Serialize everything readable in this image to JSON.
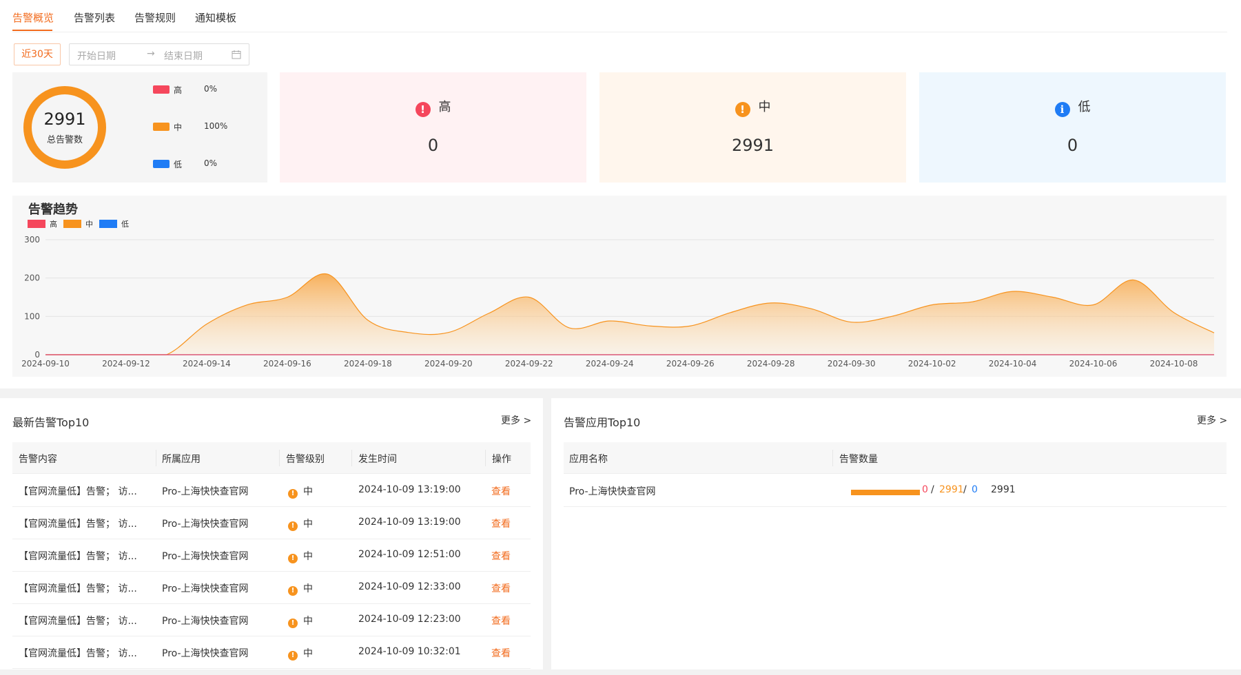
{
  "tabs": [
    {
      "label": "告警概览",
      "active": true
    },
    {
      "label": "告警列表",
      "active": false
    },
    {
      "label": "告警规则",
      "active": false
    },
    {
      "label": "通知模板",
      "active": false
    }
  ],
  "filter": {
    "quick_range": "近30天",
    "start_placeholder": "开始日期",
    "end_placeholder": "结束日期",
    "separator": "→"
  },
  "summary": {
    "total": "2991",
    "total_label": "总告警数",
    "levels": [
      {
        "name": "高",
        "percent": "0%",
        "color": "#f5475c"
      },
      {
        "name": "中",
        "percent": "100%",
        "color": "#f7931e"
      },
      {
        "name": "低",
        "percent": "0%",
        "color": "#1f7cf5"
      }
    ]
  },
  "level_cards": [
    {
      "name": "高",
      "count": "0",
      "icon": "exclamation-icon",
      "icon_color": "#f5475c",
      "bg": "#fff2f3"
    },
    {
      "name": "中",
      "count": "2991",
      "icon": "exclamation-icon",
      "icon_color": "#f7931e",
      "bg": "#fff6ed"
    },
    {
      "name": "低",
      "count": "0",
      "icon": "info-icon",
      "icon_color": "#1f7cf5",
      "bg": "#eef7fe"
    }
  ],
  "chart_data": {
    "type": "area",
    "title": "告警趋势",
    "xlabel": "",
    "ylabel": "",
    "ylim": [
      0,
      300
    ],
    "yticks": [
      0,
      100,
      200,
      300
    ],
    "x_tick_labels": [
      "2024-09-10",
      "2024-09-12",
      "2024-09-14",
      "2024-09-16",
      "2024-09-18",
      "2024-09-20",
      "2024-09-22",
      "2024-09-24",
      "2024-09-26",
      "2024-09-28",
      "2024-09-30",
      "2024-10-02",
      "2024-10-04",
      "2024-10-06",
      "2024-10-08"
    ],
    "x": [
      "2024-09-10",
      "2024-09-11",
      "2024-09-12",
      "2024-09-13",
      "2024-09-14",
      "2024-09-15",
      "2024-09-16",
      "2024-09-17",
      "2024-09-18",
      "2024-09-19",
      "2024-09-20",
      "2024-09-21",
      "2024-09-22",
      "2024-09-23",
      "2024-09-24",
      "2024-09-25",
      "2024-09-26",
      "2024-09-27",
      "2024-09-28",
      "2024-09-29",
      "2024-09-30",
      "2024-10-01",
      "2024-10-02",
      "2024-10-03",
      "2024-10-04",
      "2024-10-05",
      "2024-10-06",
      "2024-10-07",
      "2024-10-08",
      "2024-10-09"
    ],
    "series": [
      {
        "name": "高",
        "color": "#f5475c",
        "values": [
          0,
          0,
          0,
          0,
          0,
          0,
          0,
          0,
          0,
          0,
          0,
          0,
          0,
          0,
          0,
          0,
          0,
          0,
          0,
          0,
          0,
          0,
          0,
          0,
          0,
          0,
          0,
          0,
          0,
          0
        ]
      },
      {
        "name": "中",
        "color": "#f7931e",
        "values": [
          0,
          0,
          0,
          0,
          80,
          130,
          150,
          210,
          90,
          58,
          58,
          108,
          150,
          70,
          88,
          75,
          75,
          110,
          135,
          120,
          85,
          100,
          130,
          138,
          165,
          150,
          130,
          195,
          110,
          57
        ]
      },
      {
        "name": "低",
        "color": "#1f7cf5",
        "values": [
          0,
          0,
          0,
          0,
          0,
          0,
          0,
          0,
          0,
          0,
          0,
          0,
          0,
          0,
          0,
          0,
          0,
          0,
          0,
          0,
          0,
          0,
          0,
          0,
          0,
          0,
          0,
          0,
          0,
          0
        ]
      }
    ],
    "grid": true,
    "legend": "top-left"
  },
  "latest": {
    "title": "最新告警Top10",
    "more": "更多 >",
    "columns": [
      "告警内容",
      "所属应用",
      "告警级别",
      "发生时间",
      "操作"
    ],
    "rows": [
      {
        "content": "【官网流量低】告警；  访...",
        "app": "Pro-上海快快查官网",
        "level": "中",
        "time": "2024-10-09 13:19:00",
        "action": "查看"
      },
      {
        "content": "【官网流量低】告警；  访...",
        "app": "Pro-上海快快查官网",
        "level": "中",
        "time": "2024-10-09 13:19:00",
        "action": "查看"
      },
      {
        "content": "【官网流量低】告警；  访...",
        "app": "Pro-上海快快查官网",
        "level": "中",
        "time": "2024-10-09 12:51:00",
        "action": "查看"
      },
      {
        "content": "【官网流量低】告警；  访...",
        "app": "Pro-上海快快查官网",
        "level": "中",
        "time": "2024-10-09 12:33:00",
        "action": "查看"
      },
      {
        "content": "【官网流量低】告警；  访...",
        "app": "Pro-上海快快查官网",
        "level": "中",
        "time": "2024-10-09 12:23:00",
        "action": "查看"
      },
      {
        "content": "【官网流量低】告警；  访...",
        "app": "Pro-上海快快查官网",
        "level": "中",
        "time": "2024-10-09 10:32:01",
        "action": "查看"
      }
    ]
  },
  "apps": {
    "title": "告警应用Top10",
    "more": "更多 >",
    "columns": [
      "应用名称",
      "告警数量"
    ],
    "rows": [
      {
        "name": "Pro-上海快快查官网",
        "high": "0",
        "mid": "2991",
        "low": "0",
        "slash": "/",
        "total": "2991",
        "mid_share": 1
      }
    ]
  }
}
